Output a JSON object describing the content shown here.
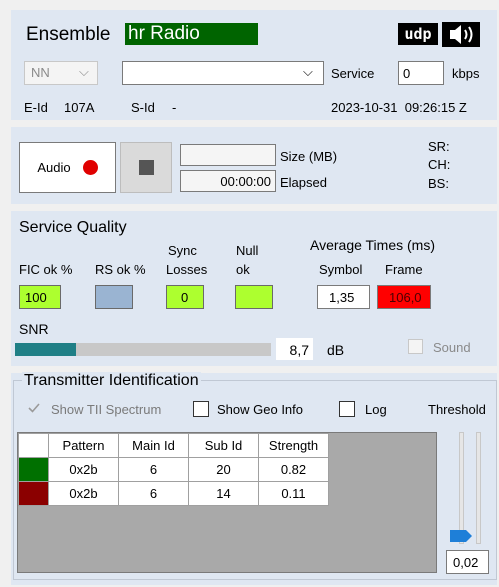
{
  "ensemble": {
    "label": "Ensemble",
    "name": "hr Radio",
    "udp_label": "udp"
  },
  "service_row": {
    "nn_value": "NN",
    "service_select_value": "",
    "service_label": "Service",
    "kbps_value": "0",
    "kbps_label": "kbps"
  },
  "ids": {
    "eid_label": "E-Id",
    "eid_value": "107A",
    "sid_label": "S-Id",
    "sid_value": "-",
    "datetime": "2023-10-31  09:26:15 Z"
  },
  "recording": {
    "audio_label": "Audio",
    "size_value": "",
    "size_label": "Size (MB)",
    "elapsed_value": "00:00:00",
    "elapsed_label": "Elapsed",
    "sr_label": "SR:",
    "ch_label": "CH:",
    "bs_label": "BS:"
  },
  "quality": {
    "title": "Service Quality",
    "fic_label": "FIC ok %",
    "rs_label": "RS ok %",
    "sync_label_1": "Sync",
    "sync_label_2": "Losses",
    "null_label_1": "Null",
    "null_label_2": "ok",
    "avg_label": "Average Times (ms)",
    "symbol_label": "Symbol",
    "frame_label": "Frame",
    "fic_value": "100",
    "rs_value": "",
    "sync_value": "0",
    "null_value": "",
    "symbol_value": "1,35",
    "frame_value": "106,0",
    "snr_label": "SNR",
    "snr_value": "8,7",
    "snr_unit": "dB",
    "snr_level": 0.24,
    "sound_label": "Sound",
    "colors": {
      "fic": "#adff2f",
      "rs": "#9ab4d2",
      "sync": "#adff2f",
      "null": "#adff2f",
      "frame": "#ff0000",
      "snr": "#1f7f86"
    }
  },
  "tii": {
    "title": "Transmitter Identification",
    "show_spectrum_label": "Show TII Spectrum",
    "show_geo_label": "Show Geo Info",
    "log_label": "Log",
    "threshold_label": "Threshold",
    "threshold_value": "0,02",
    "threshold_level": 0.02,
    "columns": [
      "Pattern",
      "Main Id",
      "Sub Id",
      "Strength"
    ],
    "rows": [
      {
        "color": "#007000",
        "pattern": "0x2b",
        "main": "6",
        "sub": "20",
        "strength": "0.82"
      },
      {
        "color": "#8b0000",
        "pattern": "0x2b",
        "main": "6",
        "sub": "14",
        "strength": "0.11"
      }
    ]
  }
}
